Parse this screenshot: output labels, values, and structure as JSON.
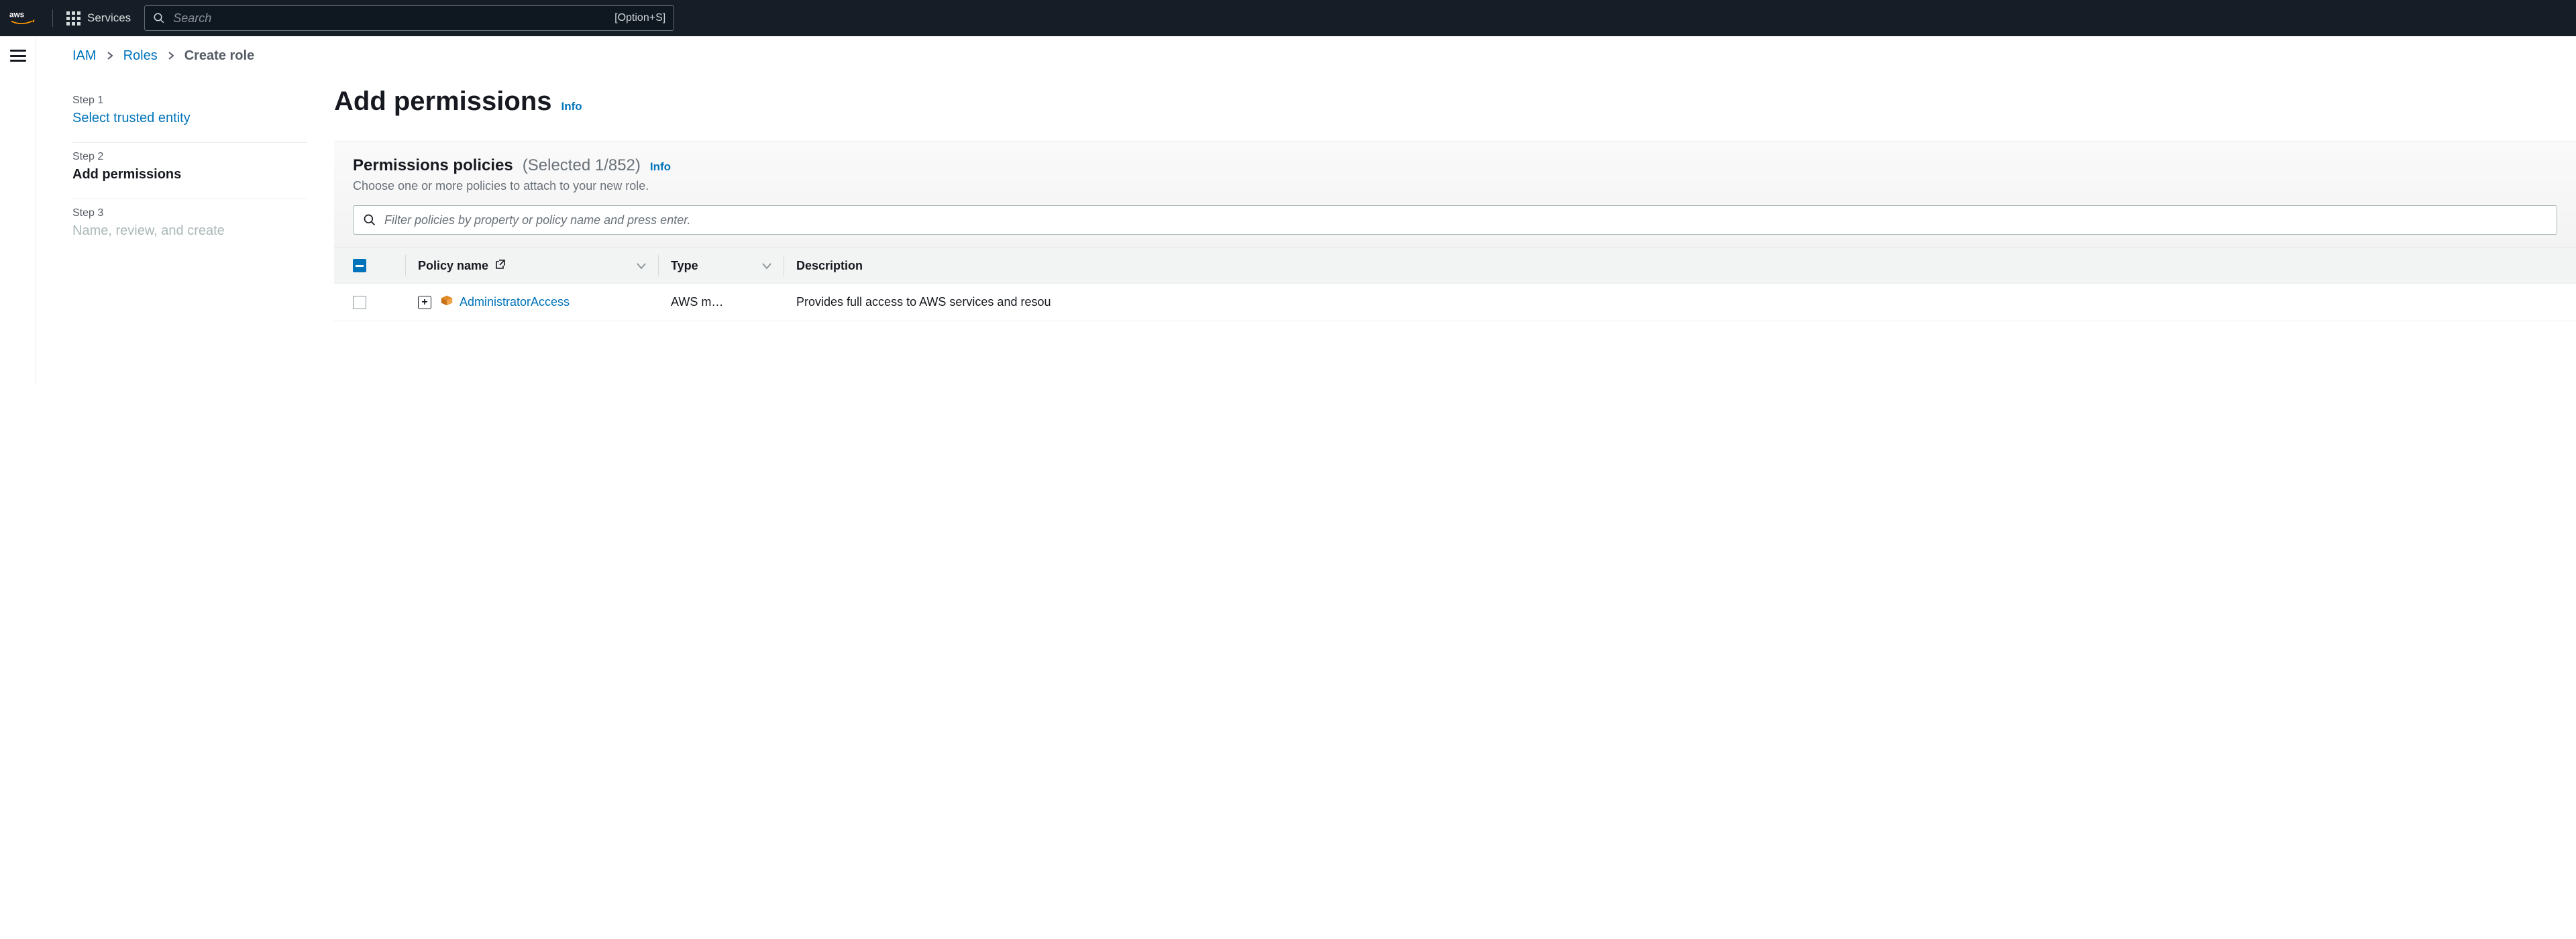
{
  "nav": {
    "services_label": "Services",
    "search_placeholder": "Search",
    "search_hint": "[Option+S]"
  },
  "breadcrumbs": {
    "root": "IAM",
    "mid": "Roles",
    "current": "Create role"
  },
  "wizard": {
    "steps": [
      {
        "label": "Step 1",
        "title": "Select trusted entity",
        "state": "link"
      },
      {
        "label": "Step 2",
        "title": "Add permissions",
        "state": "active"
      },
      {
        "label": "Step 3",
        "title": "Name, review, and create",
        "state": "future"
      }
    ]
  },
  "main": {
    "title": "Add permissions",
    "info": "Info"
  },
  "panel": {
    "title": "Permissions policies",
    "subcount": "(Selected 1/852)",
    "info": "Info",
    "description": "Choose one or more policies to attach to your new role.",
    "filter_placeholder": "Filter policies by property or policy name and press enter.",
    "columns": {
      "name": "Policy name",
      "type": "Type",
      "desc": "Description"
    },
    "rows": [
      {
        "name": "AdministratorAccess",
        "type": "AWS m…",
        "desc": "Provides full access to AWS services and resou"
      }
    ]
  }
}
